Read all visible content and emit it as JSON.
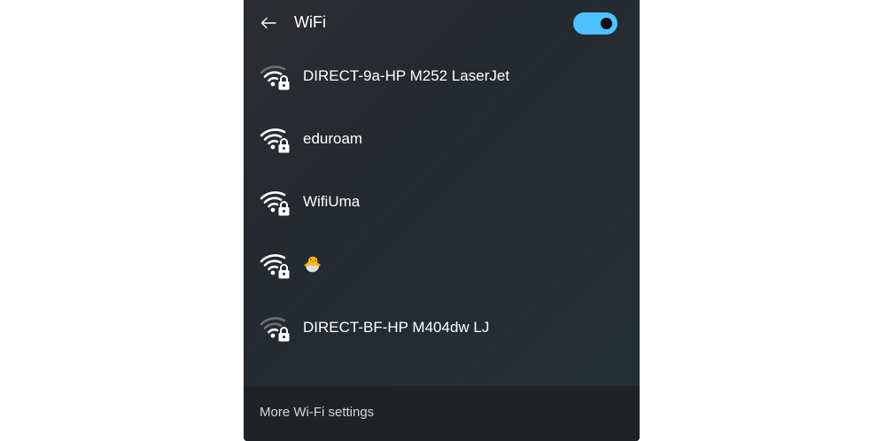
{
  "header": {
    "title": "WiFi",
    "back_icon": "back-arrow-icon",
    "toggle_on": true,
    "toggle_color": "#4cc2ff"
  },
  "networks": [
    {
      "name": "DIRECT-9a-HP M252 LaserJet",
      "secured": true,
      "signal_bars": 2,
      "icon": "wifi-secured-icon"
    },
    {
      "name": "eduroam",
      "secured": true,
      "signal_bars": 3,
      "icon": "wifi-secured-icon"
    },
    {
      "name": "WifiUma",
      "secured": true,
      "signal_bars": 3,
      "icon": "wifi-secured-icon"
    },
    {
      "name": "🐣",
      "secured": true,
      "signal_bars": 3,
      "icon": "wifi-secured-icon"
    },
    {
      "name": "DIRECT-BF-HP M404dw LJ",
      "secured": true,
      "signal_bars": 1,
      "icon": "wifi-secured-icon"
    }
  ],
  "footer": {
    "more_settings_label": "More Wi-Fi settings"
  },
  "colors": {
    "accent": "#4cc2ff",
    "panel_bg": "#262a2f",
    "footer_bg": "#202326",
    "text": "#ffffff",
    "dim_wave": "#6b6e72"
  }
}
